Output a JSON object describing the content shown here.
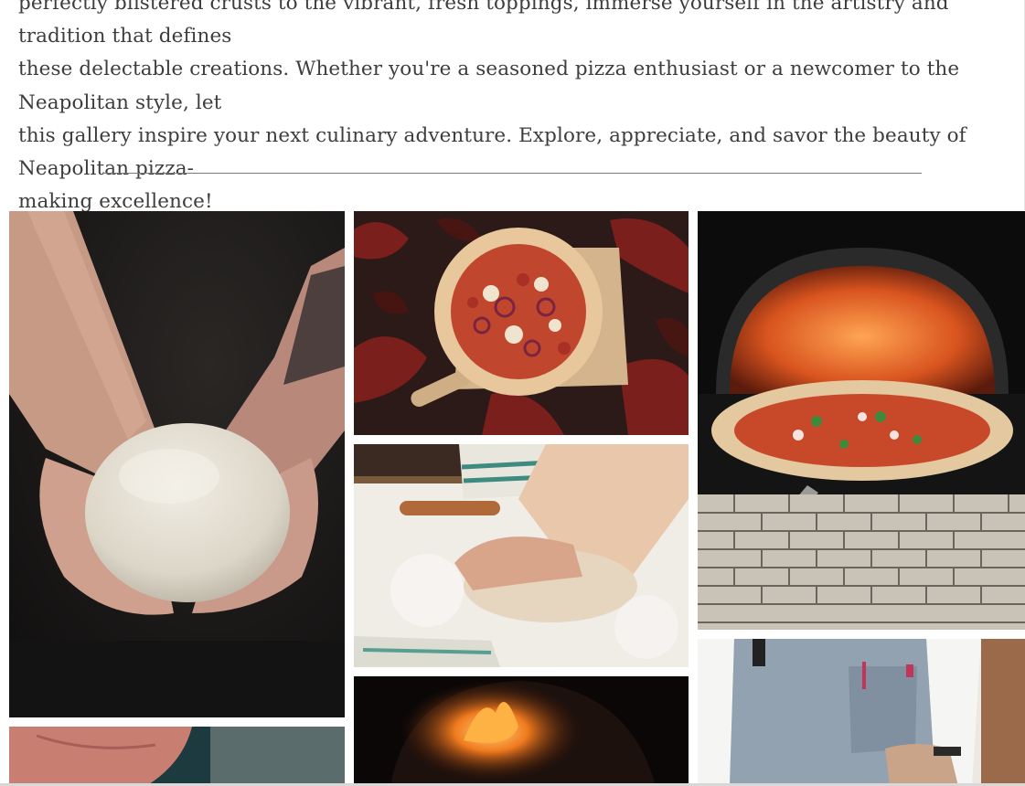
{
  "intro": {
    "text": "perfectly blistered crusts to the vibrant, fresh toppings, immerse yourself in the artistry and tradition that defines\nthese delectable creations. Whether you're a seasoned pizza enthusiast or a newcomer to the Neapolitan style, let\nthis gallery inspire your next culinary adventure. Explore, appreciate, and savor the beauty of Neapolitan pizza-\nmaking excellence!"
  },
  "gallery": {
    "photos": [
      {
        "name": "dough-ball-hands-photo",
        "subject": "hands holding dough ball"
      },
      {
        "name": "pizza-on-board-photo",
        "subject": "pizza on wooden board among red leaves"
      },
      {
        "name": "wood-fired-oven-pizza-photo",
        "subject": "pizza in front of wood-fired oven"
      },
      {
        "name": "kneading-dough-photo",
        "subject": "hands kneading dough on floured table"
      },
      {
        "name": "chef-apron-photo",
        "subject": "chef wearing denim apron"
      },
      {
        "name": "oven-fire-photo",
        "subject": "fire burning inside oven"
      },
      {
        "name": "hand-closeup-photo",
        "subject": "close-up of hand"
      }
    ]
  },
  "colors": {
    "text": "#3d3d3d",
    "divider": "#7a7a7a",
    "background": "#ffffff"
  }
}
